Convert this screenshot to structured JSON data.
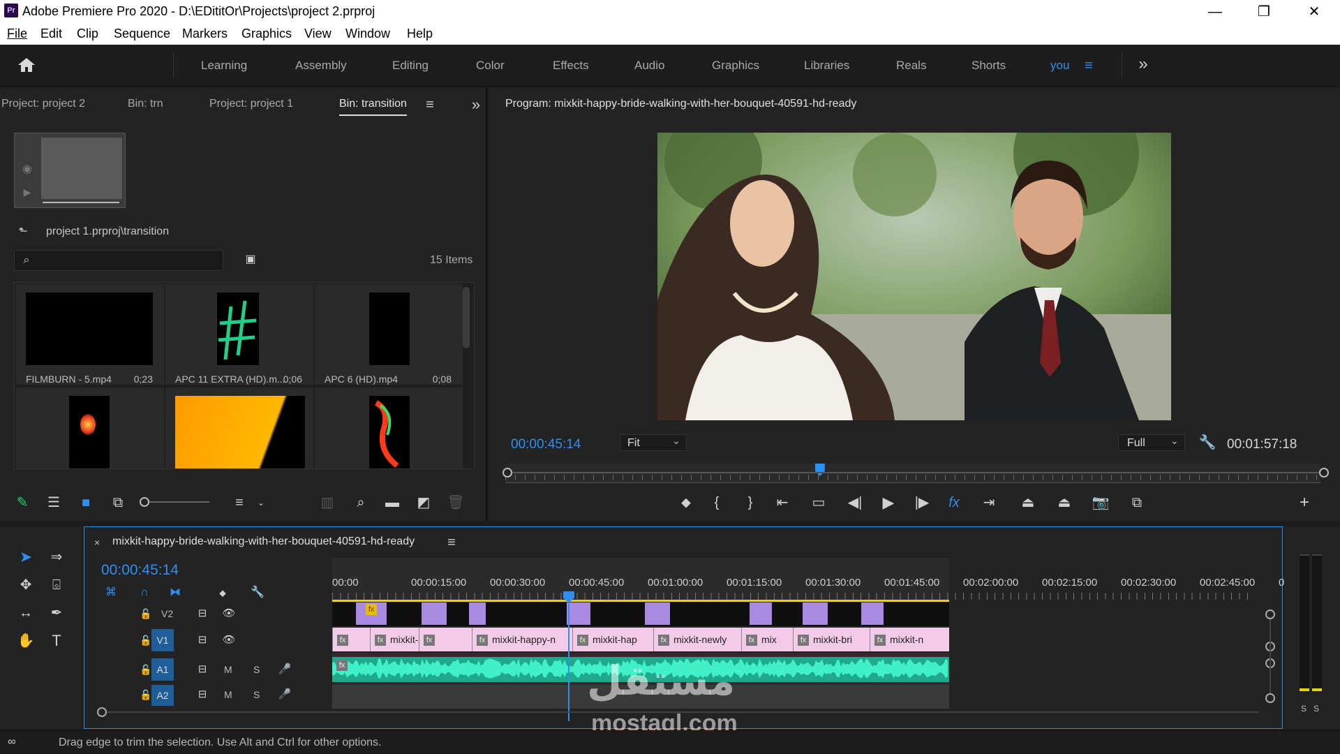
{
  "window": {
    "app_icon": "Pr",
    "title": "Adobe Premiere Pro 2020 - D:\\EDititOr\\Projects\\project 2.prproj",
    "minimize": "—",
    "maximize": "❐",
    "close": "✕"
  },
  "menu": [
    "File",
    "Edit",
    "Clip",
    "Sequence",
    "Markers",
    "Graphics",
    "View",
    "Window",
    "Help"
  ],
  "workspaces": {
    "items": [
      "Learning",
      "Assembly",
      "Editing",
      "Color",
      "Effects",
      "Audio",
      "Graphics",
      "Libraries",
      "Reals",
      "Shorts",
      "you"
    ],
    "active": "you",
    "more": "»"
  },
  "project_panel": {
    "tabs": [
      "Project: project 2",
      "Bin: trn",
      "Project: project 1",
      "Bin: transition"
    ],
    "active_tab": "Bin: transition",
    "path": "project 1.prproj\\transition",
    "search_placeholder": "",
    "item_count": "15 Items",
    "items": [
      {
        "name": "FILMBURN - 5.mp4",
        "duration": "0;23"
      },
      {
        "name": "APC 11 EXTRA (HD).m...",
        "duration": "0;06"
      },
      {
        "name": "APC 6 (HD).mp4",
        "duration": "0;08"
      },
      {
        "name": "",
        "duration": ""
      },
      {
        "name": "",
        "duration": ""
      },
      {
        "name": "",
        "duration": ""
      }
    ]
  },
  "program_monitor": {
    "title": "Program: mixkit-happy-bride-walking-with-her-bouquet-40591-hd-ready",
    "current_time": "00:00:45:14",
    "zoom": "Fit",
    "resolution": "Full",
    "duration": "00:01:57:18",
    "playhead_fraction": 0.386
  },
  "timeline": {
    "sequence_name": "mixkit-happy-bride-walking-with-her-bouquet-40591-hd-ready",
    "close": "×",
    "timecode": "00:00:45:14",
    "ruler": [
      "00:00",
      "00:00:15:00",
      "00:00:30:00",
      "00:00:45:00",
      "00:01:00:00",
      "00:01:15:00",
      "00:01:30:00",
      "00:01:45:00",
      "00:02:00:00",
      "00:02:15:00",
      "00:02:30:00",
      "00:02:45:00",
      "00"
    ],
    "tracks": [
      {
        "id": "V2",
        "type": "video"
      },
      {
        "id": "V1",
        "type": "video"
      },
      {
        "id": "A1",
        "type": "audio",
        "m": "M",
        "s": "S"
      },
      {
        "id": "A2",
        "type": "audio",
        "m": "M",
        "s": "S"
      }
    ],
    "v1_clips": [
      "",
      "mixkit-",
      "",
      "mixkit-happy-n",
      "mixkit-hap",
      "mixkit-newly",
      "mix",
      "mixkit-bri",
      "mixkit-n"
    ],
    "fx_label": "fx"
  },
  "meter": {
    "s1": "S",
    "s2": "S"
  },
  "status": {
    "message": "Drag edge to trim the selection. Use Alt and Ctrl for other options."
  },
  "watermark": {
    "arabic": "مستقل",
    "latin": "mostaql.com"
  },
  "colors": {
    "accent": "#2f8ff0",
    "clip_video": "#f3cbe8",
    "clip_v2": "#a88ae0",
    "audio_wave": "#2fd6b0",
    "work_area": "#e6d400"
  }
}
